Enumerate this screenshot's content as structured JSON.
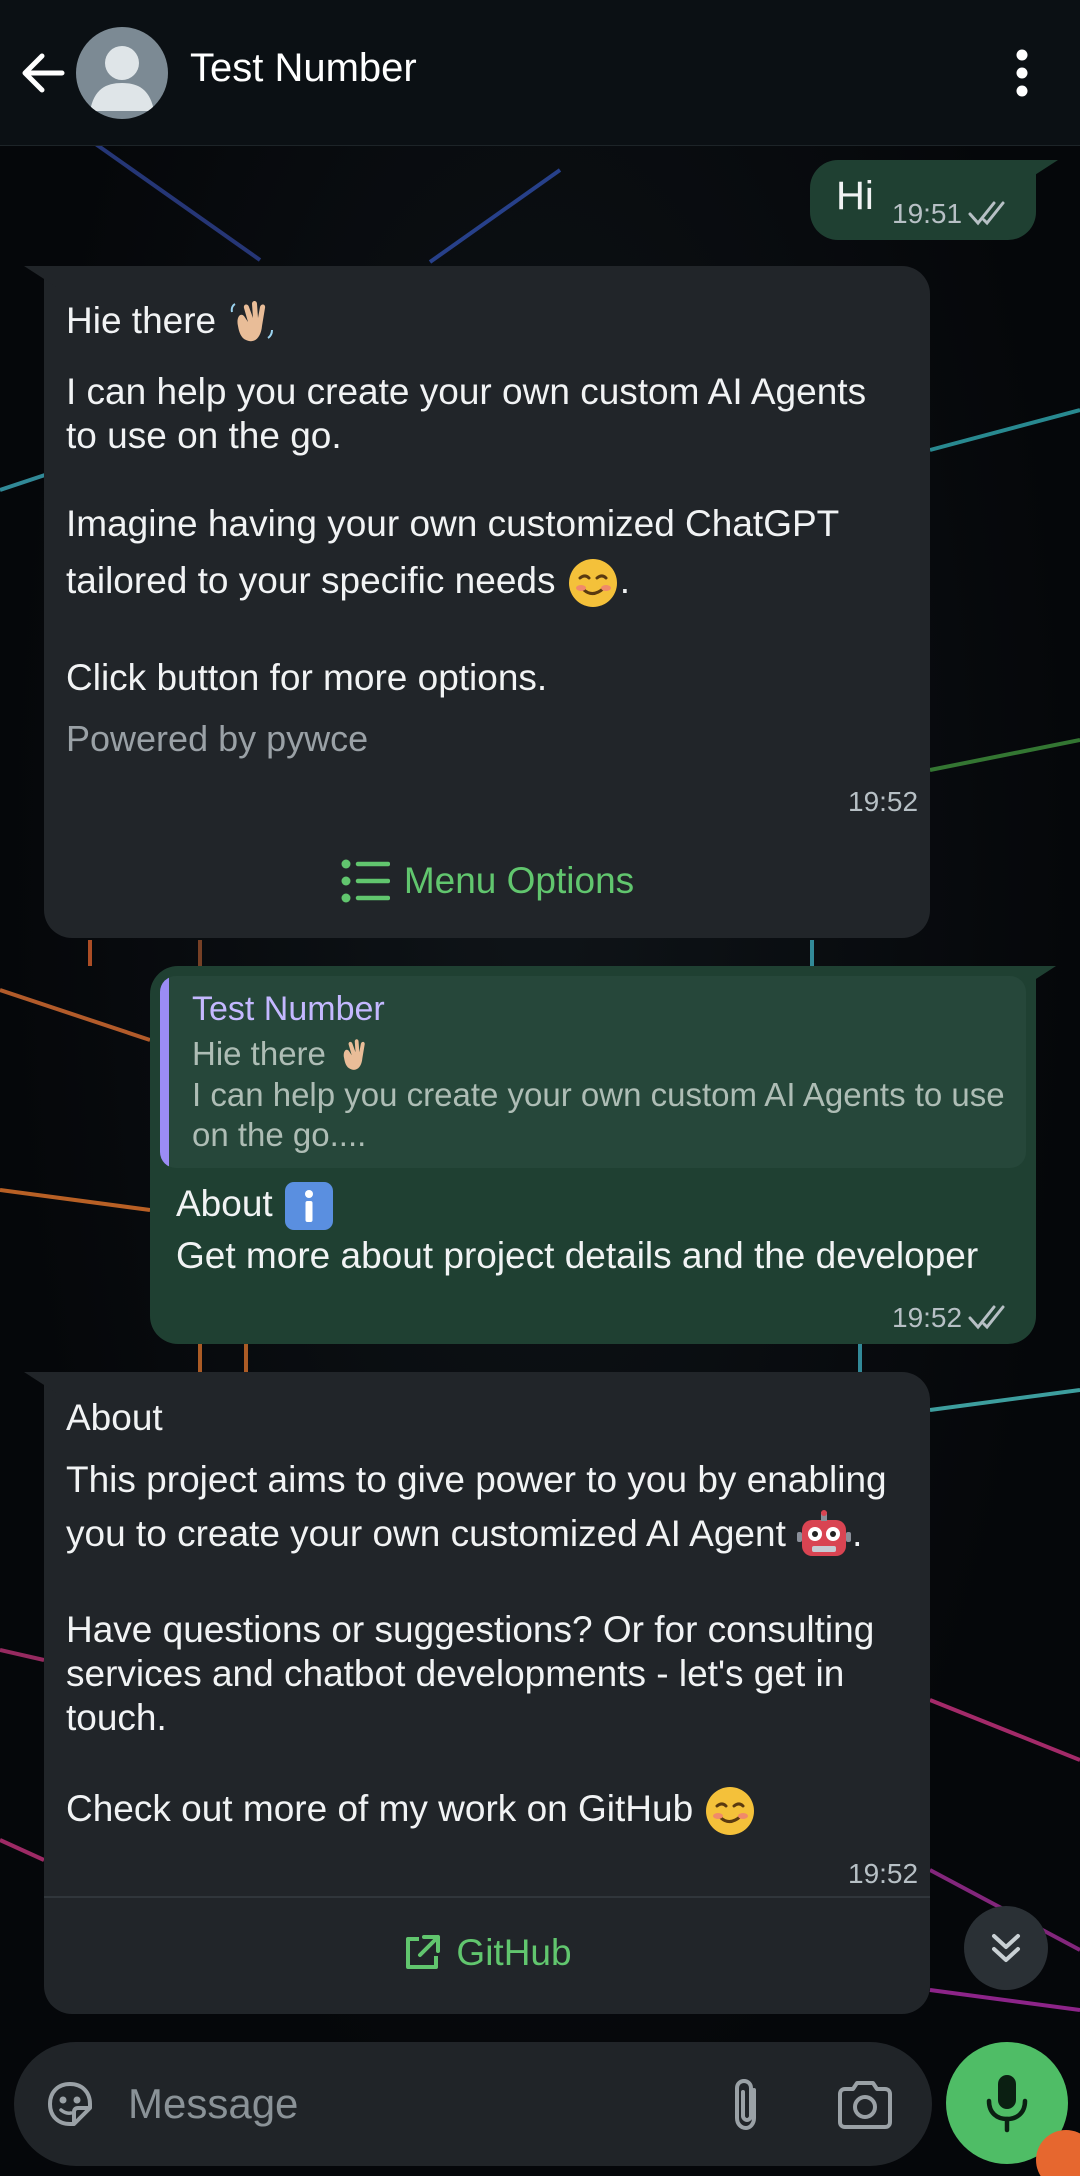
{
  "header": {
    "contact_name": "Test Number"
  },
  "messages": {
    "hi": {
      "text": "Hi",
      "time": "19:51"
    },
    "welcome": {
      "line1": "Hie there",
      "line2": "I can help you create your own custom AI Agents to use on the go.",
      "line3a": "Imagine having your own customized ChatGPT",
      "line3b": "tailored to your specific needs",
      "line4": "Click button for more options.",
      "footer": "Powered by pywce",
      "time": "19:52",
      "button_label": "Menu Options"
    },
    "about_reply": {
      "quoted_name": "Test Number",
      "quoted_line1": "Hie there",
      "quoted_line2": "I can help you create your own custom AI Agents to use on the go....",
      "title": "About",
      "description": "Get more about project details and the developer",
      "time": "19:52"
    },
    "about": {
      "header": "About",
      "para1a": "This project aims to give power to you by enabling",
      "para1b": "you to create your own customized AI Agent",
      "para2": "Have questions or suggestions? Or for consulting services and chatbot developments - let's get in touch.",
      "para3": "Check out more of my work on GitHub",
      "time": "19:52",
      "button_label": "GitHub"
    }
  },
  "composer": {
    "placeholder": "Message"
  },
  "icons": {
    "back": "arrow-left-icon",
    "more": "more-vertical-icon",
    "wave": "waving-hand-emoji",
    "smirk": "smiling-face-emoji",
    "info": "info-emoji",
    "robot": "robot-emoji",
    "menu": "list-icon",
    "external": "external-link-icon",
    "sticker": "sticker-icon",
    "attach": "paperclip-icon",
    "camera": "camera-icon",
    "mic": "microphone-icon",
    "scroll": "double-chevron-down-icon"
  },
  "colors": {
    "accent_green": "#61c66e",
    "outgoing_bubble": "#1f4032",
    "incoming_bubble": "#212529",
    "quote_bar": "#9b8cf5"
  }
}
